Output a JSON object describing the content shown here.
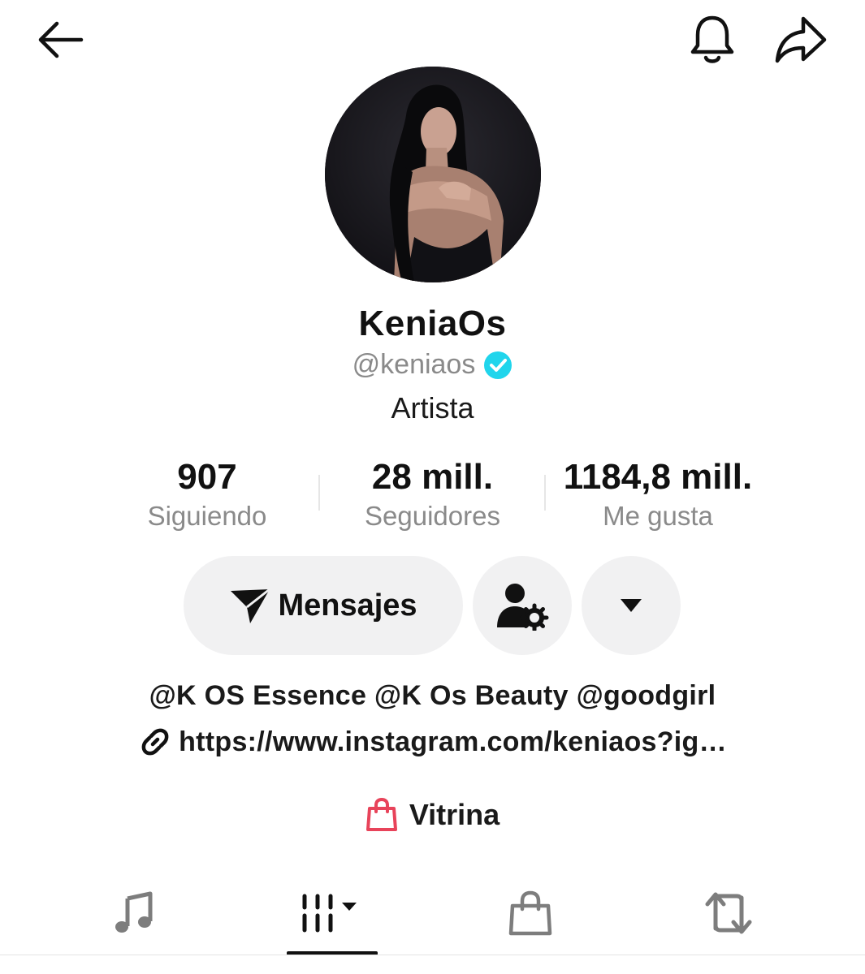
{
  "header": {
    "back_icon": "back-arrow-icon",
    "bell_icon": "bell-icon",
    "share_icon": "share-icon"
  },
  "profile": {
    "display_name": "KeniaOs",
    "username": "@keniaos",
    "verified": true,
    "verified_color": "#20d5ec",
    "category": "Artista"
  },
  "stats": [
    {
      "value": "907",
      "label": "Siguiendo"
    },
    {
      "value": "28 mill.",
      "label": "Seguidores"
    },
    {
      "value": "1184,8 mill.",
      "label": "Me gusta"
    }
  ],
  "actions": {
    "message_label": "Mensajes",
    "message_icon": "send-icon",
    "profile_settings_icon": "user-settings-icon",
    "more_icon": "dropdown-caret-icon"
  },
  "bio": {
    "line": "@K OS Essence @K Os Beauty @goodgirl",
    "link": "https://www.instagram.com/keniaos?ig…",
    "link_icon": "link-icon"
  },
  "showcase": {
    "label": "Vitrina",
    "icon": "shopping-bag-icon",
    "icon_color": "#e8435a"
  },
  "tabs": [
    {
      "icon": "music-note-icon",
      "selected": false
    },
    {
      "icon": "video-grid-icon",
      "selected": true
    },
    {
      "icon": "shopping-bag-icon",
      "selected": false
    },
    {
      "icon": "repost-icon",
      "selected": false
    }
  ]
}
